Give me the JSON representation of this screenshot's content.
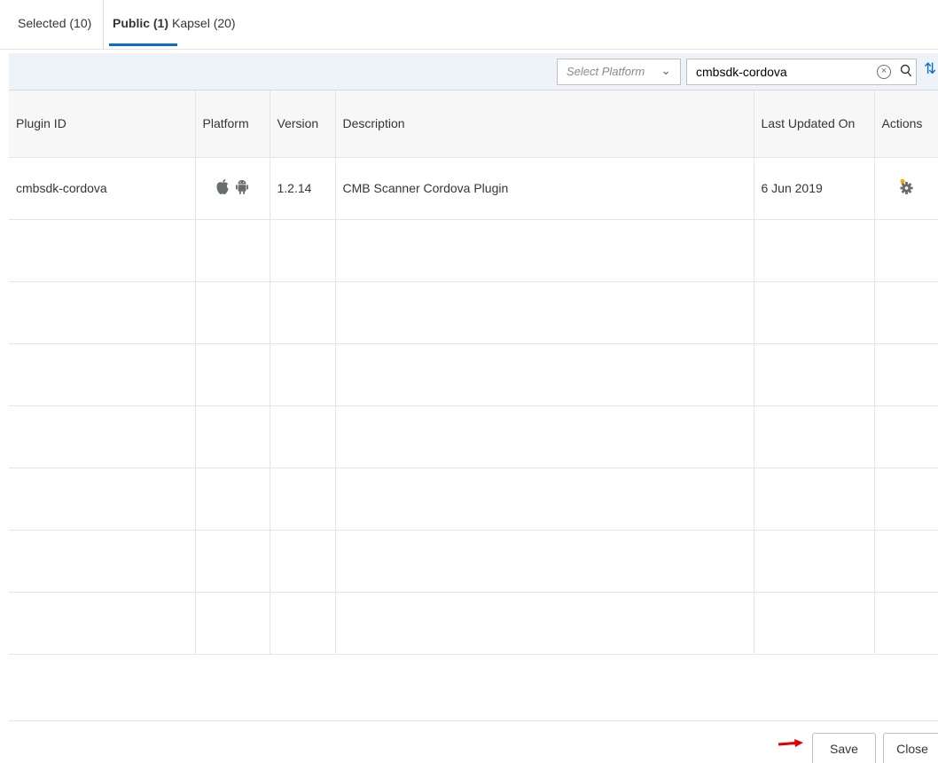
{
  "tabs": [
    {
      "label": "Selected (10)"
    },
    {
      "label": "Public (1)"
    },
    {
      "label": "Kapsel (20)"
    }
  ],
  "toolbar": {
    "platform_placeholder": "Select Platform",
    "search_value": "cmbsdk-cordova"
  },
  "table": {
    "columns": [
      "Plugin ID",
      "Platform",
      "Version",
      "Description",
      "Last Updated On",
      "Actions"
    ],
    "rows": [
      {
        "plugin_id": "cmbsdk-cordova",
        "platforms": [
          "apple-icon",
          "android-icon"
        ],
        "version": "1.2.14",
        "description": "CMB Scanner Cordova Plugin",
        "last_updated": "6 Jun 2019",
        "action_icon": "gear-icon"
      }
    ],
    "empty_rows": 7
  },
  "footer": {
    "save_label": "Save",
    "close_label": "Close"
  },
  "colors": {
    "accent": "#0a6ed1",
    "toolbar_bg": "#eef3f8",
    "arrow": "#e00000"
  }
}
